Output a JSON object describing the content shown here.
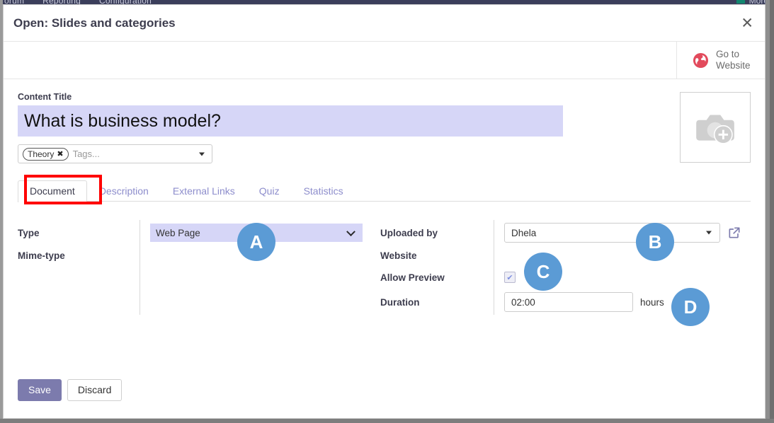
{
  "background": {
    "menu_items_partial": [
      "orum",
      "Reporting",
      "Configuration"
    ],
    "right_partial": "More",
    "topbar_color": "#3b3e5b"
  },
  "modal": {
    "title": "Open: Slides and categories",
    "close_icon": "close-icon",
    "statusbar": {
      "goto_website_label": "Go to\nWebsite",
      "goto_website_line1": "Go to",
      "goto_website_line2": "Website",
      "globe_icon": "globe-icon",
      "globe_color": "#e24a5c"
    },
    "content_title": {
      "label": "Content Title",
      "value": "What is business model?",
      "highlight_color": "#d6d6f7"
    },
    "tags": {
      "pills": [
        "Theory"
      ],
      "remove_icon": "✖",
      "placeholder": "Tags...",
      "caret_icon": "chevron-down-icon"
    },
    "image_placeholder": {
      "icon": "camera-add-icon",
      "color": "#cfcfcf"
    },
    "tabs": [
      {
        "label": "Document",
        "active": true
      },
      {
        "label": "Description",
        "active": false
      },
      {
        "label": "External Links",
        "active": false
      },
      {
        "label": "Quiz",
        "active": false
      },
      {
        "label": "Statistics",
        "active": false
      }
    ],
    "tab_highlight_color": "#ff0000",
    "form": {
      "left": {
        "type": {
          "label": "Type",
          "value": "Web Page",
          "highlight_color": "#d6d6f7"
        },
        "mime_type": {
          "label": "Mime-type",
          "value": ""
        }
      },
      "right": {
        "uploaded_by": {
          "label": "Uploaded by",
          "value": "Dhela",
          "external_link_icon": "external-link-icon"
        },
        "website": {
          "label": "Website",
          "value": ""
        },
        "allow_preview": {
          "label": "Allow Preview",
          "checked": true,
          "check_icon": "✔"
        },
        "duration": {
          "label": "Duration",
          "value": "02:00",
          "unit": "hours"
        }
      }
    },
    "footer": {
      "save_label": "Save",
      "discard_label": "Discard",
      "save_color": "#7c7bad"
    }
  },
  "annotations": [
    {
      "id": "A",
      "letter": "A",
      "target": "type-select"
    },
    {
      "id": "B",
      "letter": "B",
      "target": "uploaded-by-select"
    },
    {
      "id": "C",
      "letter": "C",
      "target": "allow-preview-checkbox"
    },
    {
      "id": "D",
      "letter": "D",
      "target": "duration-input"
    }
  ],
  "annotation_color": "#5b9bd5"
}
